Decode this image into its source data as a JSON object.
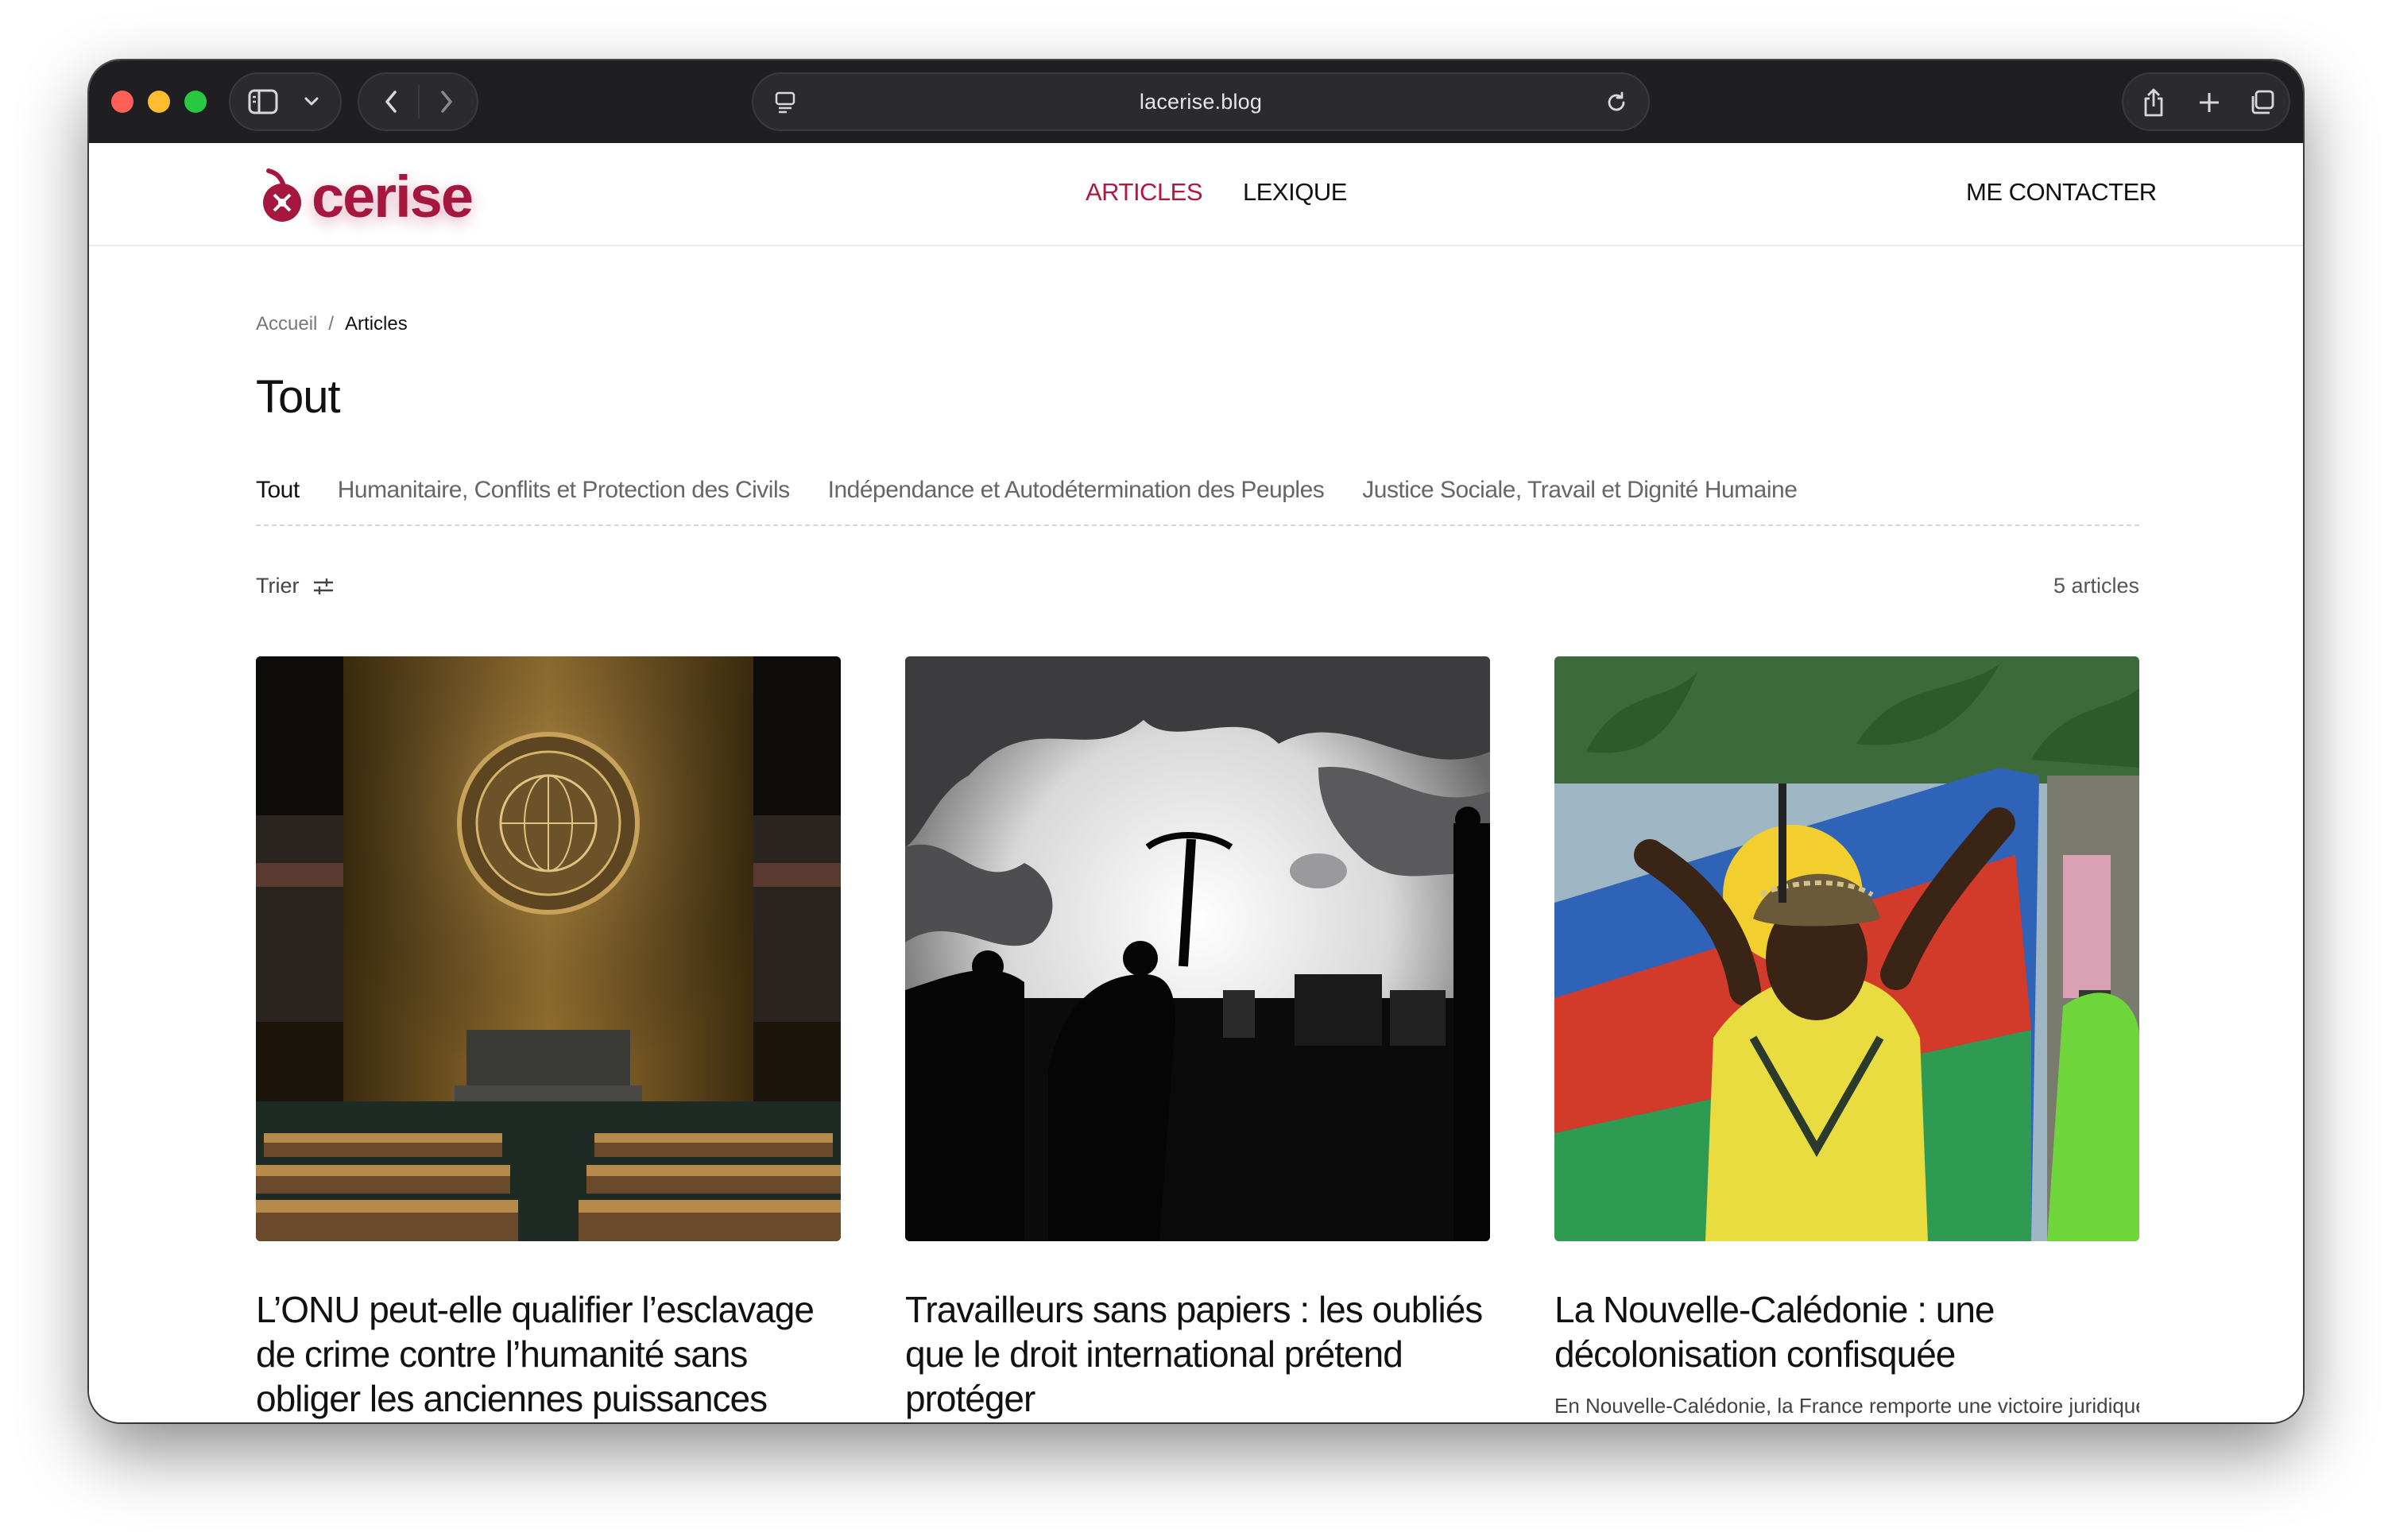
{
  "browser": {
    "url": "lacerise.blog",
    "icons": [
      "sidebar-icon",
      "chevron-down-icon",
      "back-icon",
      "forward-icon",
      "page-menu-icon",
      "reload-icon",
      "share-icon",
      "new-tab-icon",
      "tabs-overview-icon"
    ]
  },
  "site": {
    "logo_text": "cerise",
    "brand_color": "#a5173f",
    "nav": [
      {
        "label": "ARTICLES",
        "active": true
      },
      {
        "label": "LEXIQUE",
        "active": false
      }
    ],
    "contact_label": "ME CONTACTER"
  },
  "breadcrumb": {
    "home": "Accueil",
    "separator": "/",
    "current": "Articles"
  },
  "page_title": "Tout",
  "tabs": [
    {
      "label": "Tout",
      "active": true
    },
    {
      "label": "Humanitaire, Conflits et Protection des Civils",
      "active": false
    },
    {
      "label": "Indépendance et Autodétermination des Peuples",
      "active": false
    },
    {
      "label": "Justice Sociale, Travail et Dignité Humaine",
      "active": false
    }
  ],
  "sort": {
    "label": "Trier",
    "icon": "sliders-icon"
  },
  "article_count": "5 articles",
  "articles": [
    {
      "title": "L’ONU peut-elle qualifier l’esclavage de crime contre l’humanité sans obliger les anciennes puissances",
      "image": "un-general-assembly-photo",
      "excerpt": ""
    },
    {
      "title": "Travailleurs sans papiers : les oubliés que le droit international prétend protéger",
      "image": "workers-silhouette-photo",
      "excerpt": ""
    },
    {
      "title": "La Nouvelle-Calédonie : une décolonisation confisquée",
      "image": "kanak-flag-woman-photo",
      "excerpt": "En Nouvelle-Calédonie, la France remporte une victoire juridique"
    }
  ]
}
